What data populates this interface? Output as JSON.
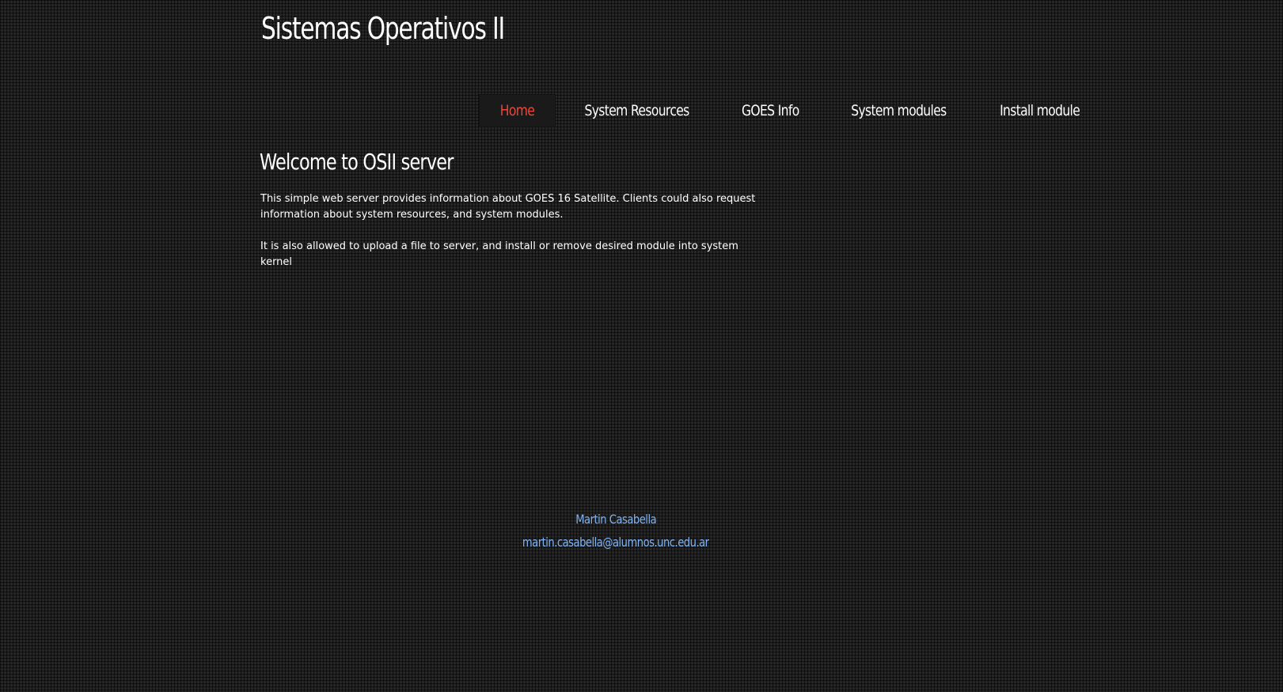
{
  "site": {
    "title": "Sistemas Operativos II"
  },
  "nav": {
    "items": [
      {
        "label": "Home",
        "active": true
      },
      {
        "label": "System Resources",
        "active": false
      },
      {
        "label": "GOES Info",
        "active": false
      },
      {
        "label": "System modules",
        "active": false
      },
      {
        "label": "Install module",
        "active": false
      }
    ]
  },
  "main": {
    "heading": "Welcome to OSII server",
    "paragraphs": [
      "This simple web server provides information about GOES 16 Satellite. Clients could also request information about system resources, and system modules.",
      "It is also allowed to upload a file to server, and install or remove desired module into system kernel"
    ]
  },
  "footer": {
    "author": "Martin Casabella",
    "email": "martin.casabella@alumnos.unc.edu.ar"
  },
  "colors": {
    "background": "#262626",
    "active_nav": "#e8493a",
    "footer_link": "#7fb3f5",
    "text": "#ffffff"
  }
}
